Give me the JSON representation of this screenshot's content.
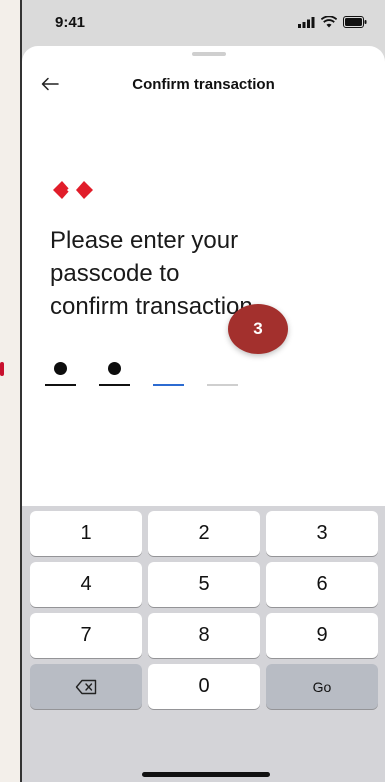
{
  "status_bar": {
    "time": "9:41"
  },
  "header": {
    "title": "Confirm transaction"
  },
  "content": {
    "heading_lines": [
      "Please enter your",
      "passcode to",
      "confirm transaction"
    ],
    "step_badge": "3"
  },
  "pin": {
    "length": 4,
    "filled": 2
  },
  "keypad": {
    "row1": [
      "1",
      "2",
      "3"
    ],
    "row2": [
      "4",
      "5",
      "6"
    ],
    "row3": [
      "7",
      "8",
      "9"
    ],
    "zero": "0",
    "go_label": "Go"
  },
  "colors": {
    "brand_red": "#e11d2a",
    "badge": "#a3302d",
    "active_line": "#2c6bd1"
  },
  "icons": [
    "back-arrow-icon",
    "signal-icon",
    "wifi-icon",
    "battery-icon",
    "backspace-icon",
    "brand-logo"
  ]
}
